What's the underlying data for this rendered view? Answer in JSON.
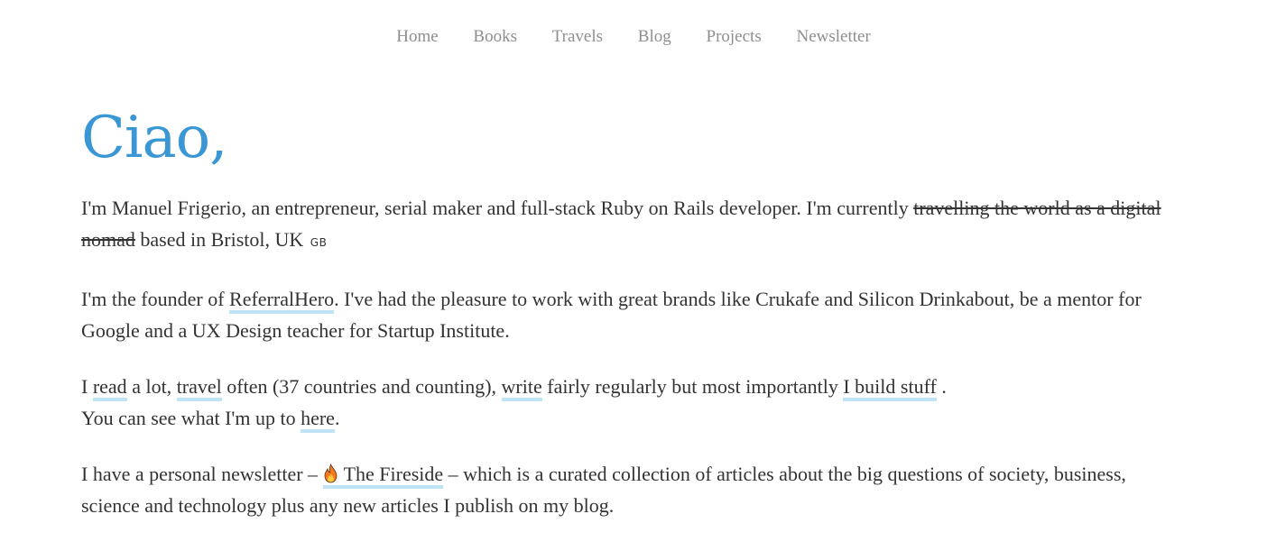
{
  "nav": {
    "items": [
      {
        "label": "Home"
      },
      {
        "label": "Books"
      },
      {
        "label": "Travels"
      },
      {
        "label": "Blog"
      },
      {
        "label": "Projects"
      },
      {
        "label": "Newsletter"
      }
    ]
  },
  "greeting": "Ciao,",
  "intro": {
    "text_before": "I'm Manuel Frigerio, an entrepreneur, serial maker and full-stack Ruby on Rails developer. I'm currently ",
    "strikethrough": "travelling the world as a digital nomad",
    "text_after": " based in Bristol, UK ",
    "flag": "GB"
  },
  "founder": {
    "text_before": "I'm the founder of ",
    "link": "ReferralHero",
    "text_after": ". I've had the pleasure to work with great brands like Crukafe and Silicon Drinkabout, be a mentor for Google and a UX Design teacher for Startup Institute."
  },
  "activities": {
    "t1": "I ",
    "link_read": "read",
    "t2": " a lot, ",
    "link_travel": "travel",
    "t3": " often (37 countries and counting), ",
    "link_write": "write",
    "t4": " fairly regularly but most importantly ",
    "link_build": "I build stuff",
    "t5": " .",
    "line2_before": "You can see what I'm up to ",
    "link_here": "here",
    "line2_after": "."
  },
  "newsletter": {
    "text_before": "I have a personal newsletter – ",
    "icon": "fire-icon",
    "link": "The Fireside",
    "text_after": " – which is a curated collection of articles about the big questions of society, business, science and technology plus any new articles I publish on my blog."
  },
  "colors": {
    "accent": "#3a97d4",
    "nav_text": "#8f8f8f",
    "body_text": "#333333",
    "link_underline": "#bde3f4"
  }
}
